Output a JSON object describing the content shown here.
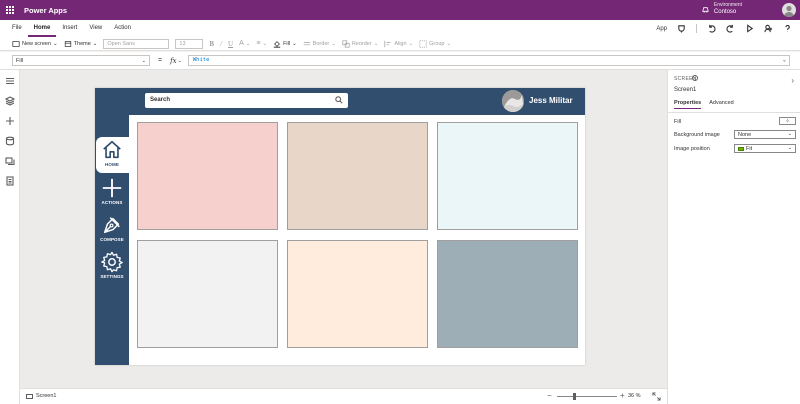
{
  "titlebar": {
    "app_title": "Power Apps",
    "environment_label": "Environment",
    "environment_name": "Contoso"
  },
  "menu": {
    "items": [
      "File",
      "Home",
      "Insert",
      "View",
      "Action"
    ],
    "active": "Home",
    "app_label": "App"
  },
  "toolbar": {
    "new_screen": "New screen",
    "theme": "Theme",
    "font": "Open Sans",
    "font_size": "13",
    "fill": "Fill",
    "border": "Border",
    "reorder": "Reorder",
    "align": "Align",
    "group": "Group"
  },
  "formula": {
    "property": "Fill",
    "equals": "=",
    "fx": "fx",
    "value": "White"
  },
  "app_screen": {
    "search_label": "Search",
    "user_name": "Jess Militar",
    "nav": {
      "home": "HOME",
      "actions": "ACTIONS",
      "compose": "COMPOSE",
      "settings": "SETTINGS"
    },
    "header_color": "#314e6f",
    "tile_colors": [
      "#f6d0cd",
      "#e8d6c8",
      "#eaf6f7",
      "#f2f2f2",
      "#ffecdd",
      "#9daeb7"
    ]
  },
  "statusbar": {
    "screen_name": "Screen1",
    "zoom": "36",
    "zoom_unit": "%",
    "zoom_minus": "−",
    "zoom_plus": "+"
  },
  "properties_panel": {
    "type_label": "SCREEN",
    "name": "Screen1",
    "tabs": [
      "Properties",
      "Advanced"
    ],
    "fill_label": "Fill",
    "background_image_label": "Background image",
    "background_image_value": "None",
    "image_position_label": "Image position",
    "image_position_value": "Fit"
  },
  "colors": {
    "brand_purple": "#742774",
    "accent_blue": "#0078d4"
  }
}
